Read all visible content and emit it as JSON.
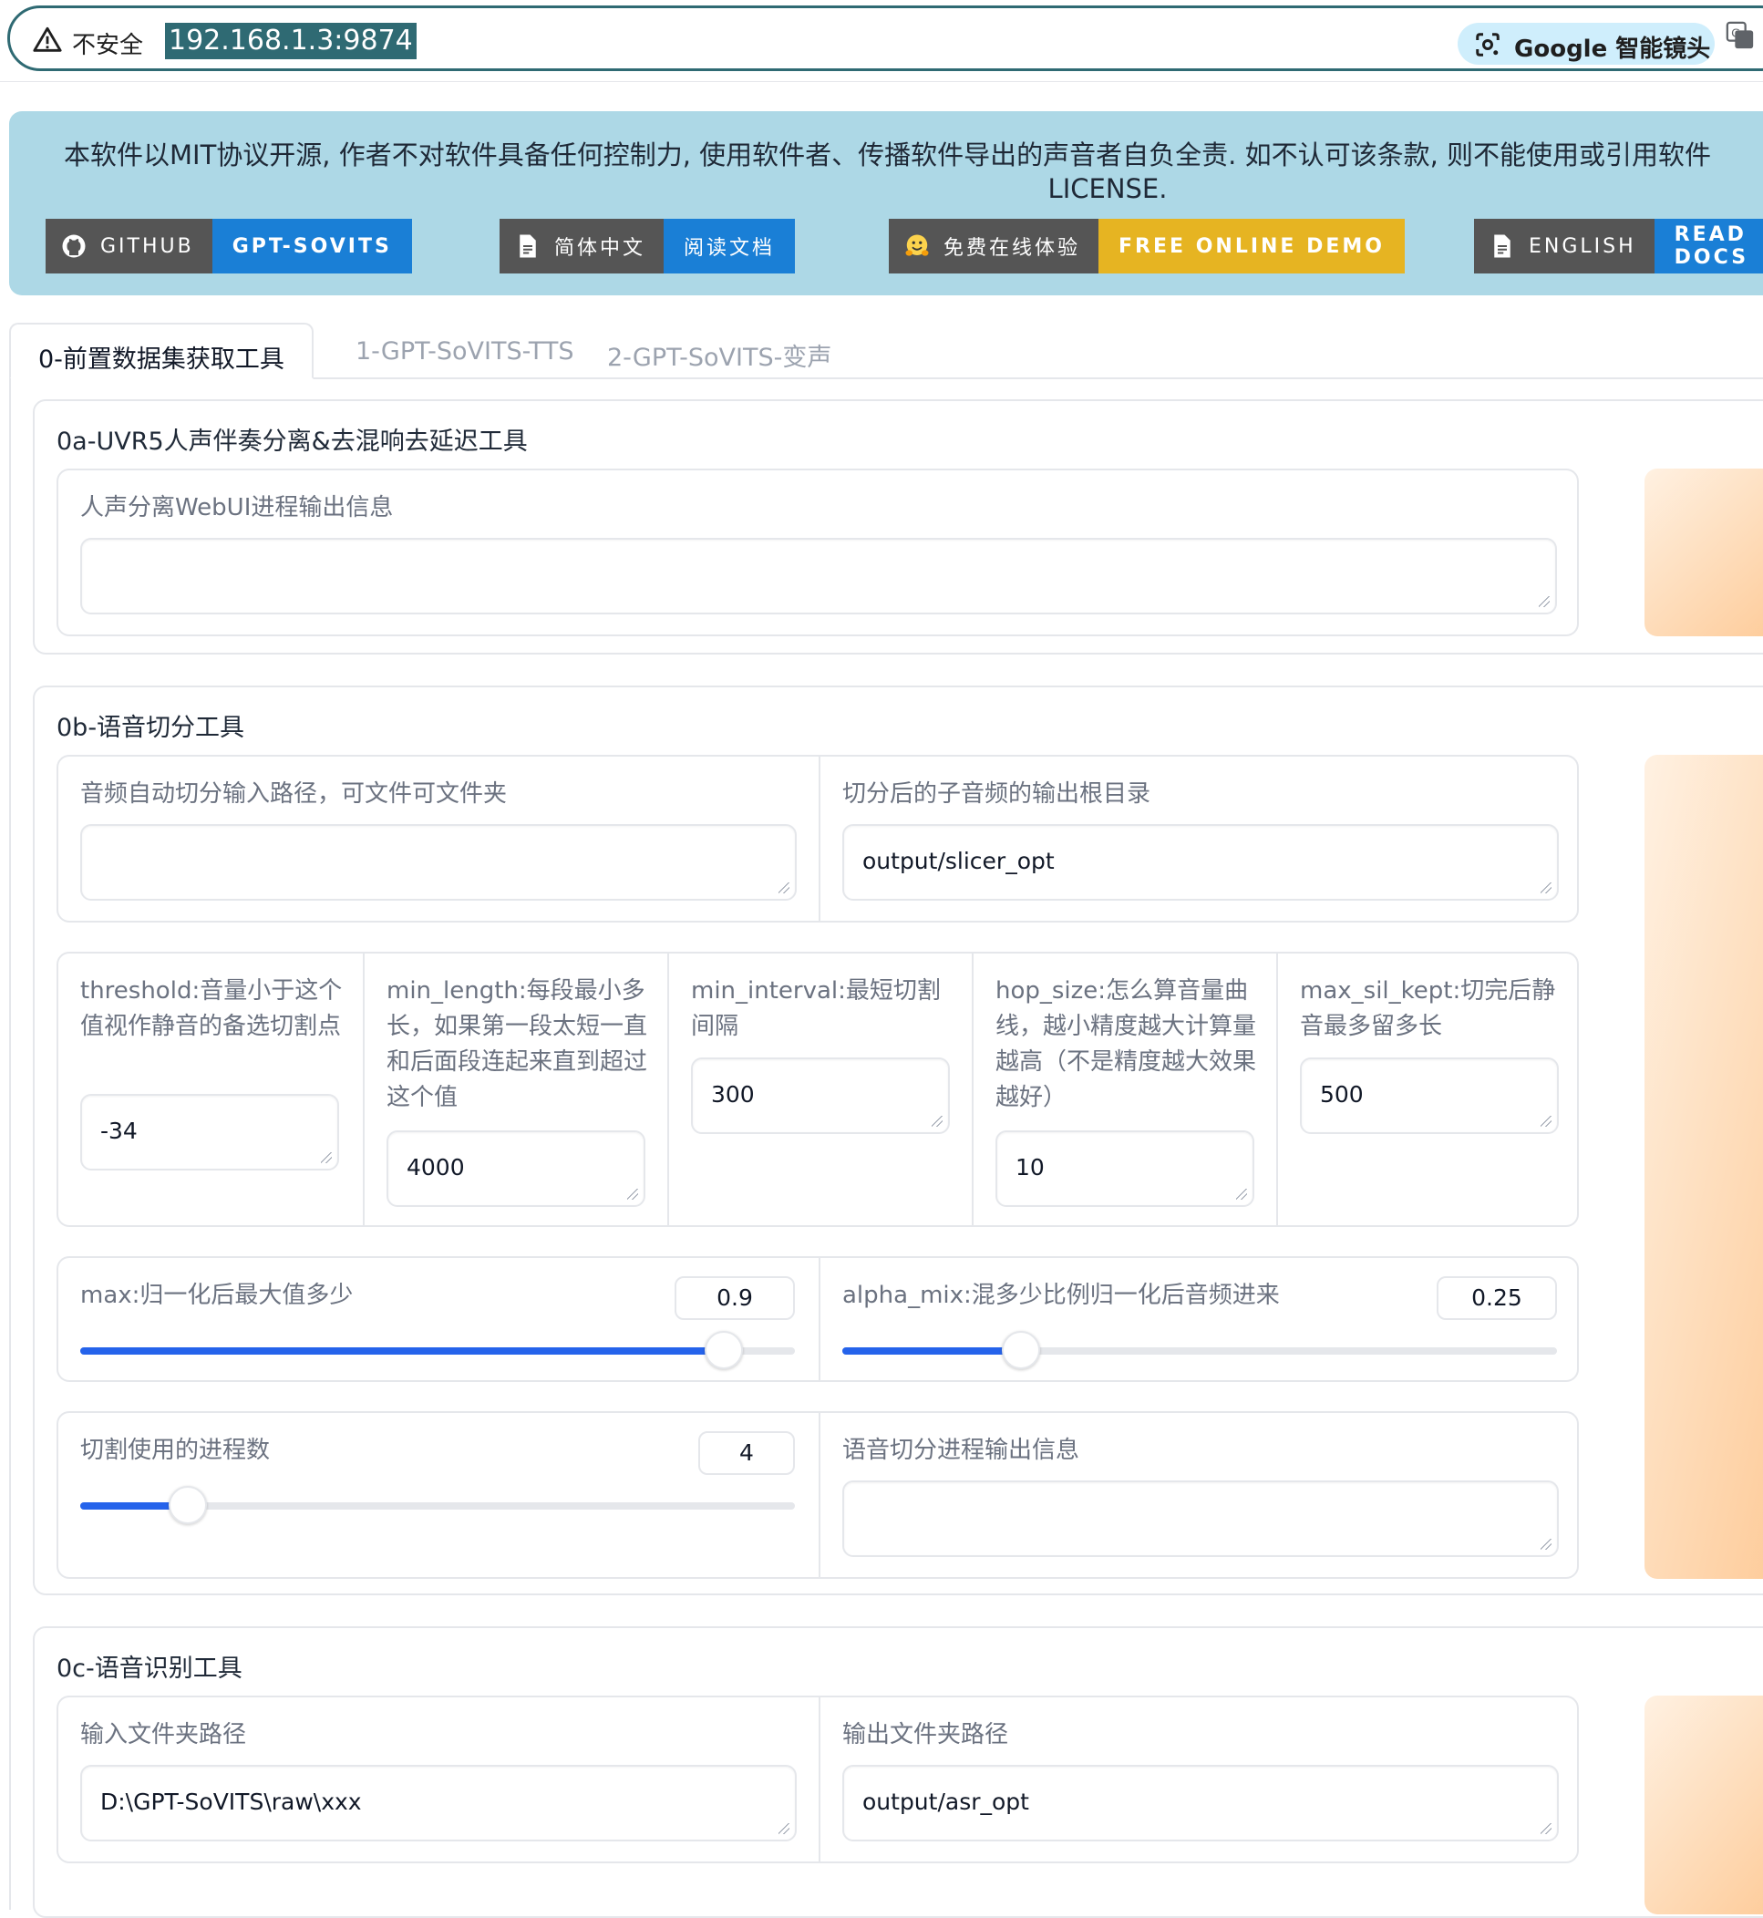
{
  "browser": {
    "insecure_label": "不安全",
    "url": "192.168.1.3:9874",
    "lens_label": "Google 智能镜头"
  },
  "banner": {
    "license_text": "本软件以MIT协议开源, 作者不对软件具备任何控制力, 使用软件者、传播软件导出的声音者自负全责. 如不认可该条款, 则不能使用或引用软件",
    "license_text2": "LICENSE.",
    "badges": [
      {
        "left": "GITHUB",
        "right": "GPT-SOVITS",
        "color": "#1a7fd6"
      },
      {
        "left": "简体中文",
        "right": "阅读文档",
        "color": "#1a7fd6"
      },
      {
        "left": "免费在线体验",
        "right": "FREE ONLINE DEMO",
        "color": "#e6b422"
      },
      {
        "left": "ENGLISH",
        "right": "READ DOCS",
        "color": "#1a7fd6"
      }
    ]
  },
  "tabs": [
    "0-前置数据集获取工具",
    "1-GPT-SoVITS-TTS",
    "2-GPT-SoVITS-变声"
  ],
  "uvr5": {
    "title": "0a-UVR5人声伴奏分离&去混响去延迟工具",
    "output_label": "人声分离WebUI进程输出信息",
    "output_value": ""
  },
  "slicer": {
    "title": "0b-语音切分工具",
    "input_label": "音频自动切分输入路径，可文件可文件夹",
    "input_value": "",
    "output_label": "切分后的子音频的输出根目录",
    "output_value": "output/slicer_opt",
    "threshold_label": "threshold:音量小于这个值视作静音的备选切割点",
    "threshold_value": "-34",
    "min_length_label": "min_length:每段最小多长，如果第一段太短一直和后面段连起来直到超过这个值",
    "min_length_value": "4000",
    "min_interval_label": "min_interval:最短切割间隔",
    "min_interval_value": "300",
    "hop_size_label": "hop_size:怎么算音量曲线，越小精度越大计算量越高（不是精度越大效果越好）",
    "hop_size_value": "10",
    "max_sil_label": "max_sil_kept:切完后静音最多留多长",
    "max_sil_value": "500",
    "max_label": "max:归一化后最大值多少",
    "max_value": "0.9",
    "max_fraction": 0.9,
    "alpha_label": "alpha_mix:混多少比例归一化后音频进来",
    "alpha_value": "0.25",
    "alpha_fraction": 0.25,
    "procs_label": "切割使用的进程数",
    "procs_value": "4",
    "procs_fraction": 0.15,
    "log_label": "语音切分进程输出信息",
    "log_value": ""
  },
  "asr": {
    "title": "0c-语音识别工具",
    "input_label": "输入文件夹路径",
    "input_value": "D:\\GPT-SoVITS\\raw\\xxx",
    "output_label": "输出文件夹路径",
    "output_value": "output/asr_opt"
  }
}
